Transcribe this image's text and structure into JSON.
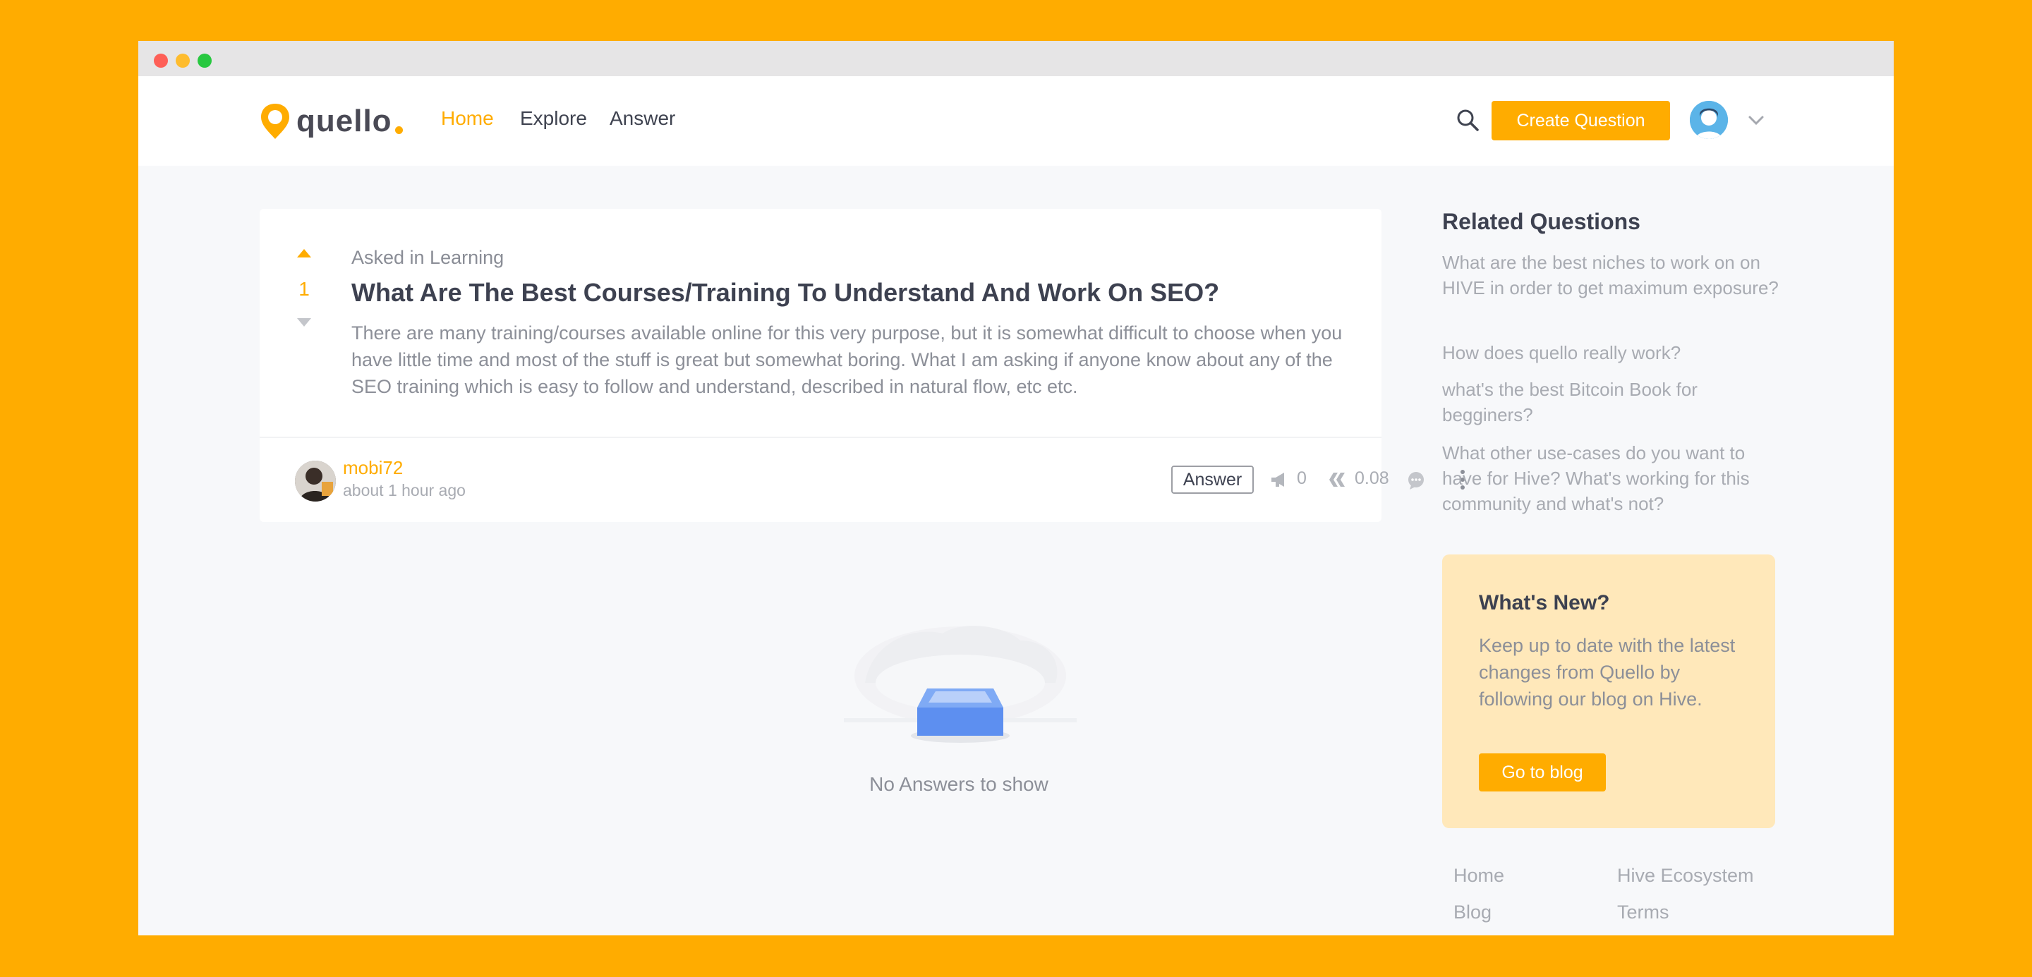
{
  "colors": {
    "brand": "#FFAC00",
    "background": "#F7F8FA",
    "text_dark": "#3D4150",
    "text_muted": "#8C8F98",
    "news_bg": "#FFE8BA"
  },
  "window": {
    "controls": [
      "close",
      "minimize",
      "maximize"
    ]
  },
  "navbar": {
    "logo_text": "quello",
    "links": [
      {
        "label": "Home",
        "active": true
      },
      {
        "label": "Explore",
        "active": false
      },
      {
        "label": "Answer",
        "active": false
      }
    ],
    "search_icon": "search-icon",
    "create_label": "Create Question",
    "user_menu_icon": "chevron-down-icon"
  },
  "question": {
    "votes": "1",
    "category": "Asked in Learning",
    "title": "What Are The Best Courses/Training To Understand And Work On SEO?",
    "body": "There are many training/courses available online for this very purpose, but it is somewhat difficult to choose when you have little time and most of the stuff is great but somewhat boring. What I am asking if anyone know about any of the SEO training which is easy to follow and understand, described in natural flow, etc etc.",
    "author": "mobi72",
    "time": "about 1 hour ago",
    "answer_label": "Answer",
    "reblogs": "0",
    "payout": "0.08",
    "icons": [
      "megaphone-icon",
      "hive-icon",
      "comment-icon",
      "more-vertical-icon"
    ]
  },
  "answers": {
    "empty_text": "No Answers to show",
    "empty_icon": "empty-inbox-icon"
  },
  "sidebar": {
    "related_title": "Related Questions",
    "related": [
      "What are the best niches to work on on HIVE in order to get maximum exposure?",
      "How does quello really work?",
      "what's the best Bitcoin Book for begginers?",
      "What other use-cases do you want to have for Hive? What's working for this community and what's not?"
    ],
    "news_title": "What's New?",
    "news_body": "Keep up to date with the latest changes from Quello by following our blog on Hive.",
    "news_button": "Go to blog",
    "footer_links": [
      "Home",
      "Hive Ecosystem",
      "Blog",
      "Terms"
    ]
  }
}
